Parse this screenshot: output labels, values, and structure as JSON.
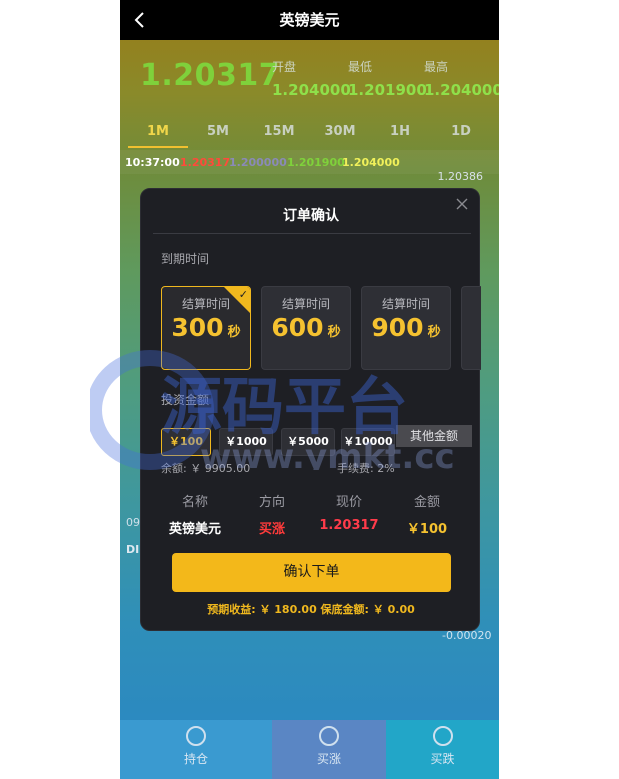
{
  "header": {
    "title": "英镑美元",
    "back_icon": "chevron-left-icon"
  },
  "quote": {
    "price": "1.20317",
    "open_label": "开盘",
    "open_value": "1.204000",
    "low_label": "最低",
    "low_value": "1.201900",
    "high_label": "最高",
    "high_value": "1.204000"
  },
  "tabs": [
    "1M",
    "5M",
    "15M",
    "30M",
    "1H",
    "1D"
  ],
  "active_tab": "1M",
  "chart_bar": {
    "time": "10:37:00",
    "v1": "1.20317",
    "v2": "1.200000",
    "v3": "1.201900",
    "v4": "1.204000"
  },
  "chart_side": {
    "top_label": "1.20386",
    "bottom_label": "-0.00020",
    "time_label": "09",
    "indicator_label": "DI"
  },
  "modal": {
    "title": "订单确认",
    "expiry_label": "到期时间",
    "time_cards": [
      {
        "label": "结算时间",
        "value": "300",
        "unit": "秒",
        "selected": true
      },
      {
        "label": "结算时间",
        "value": "600",
        "unit": "秒",
        "selected": false
      },
      {
        "label": "结算时间",
        "value": "900",
        "unit": "秒",
        "selected": false
      }
    ],
    "invest_label": "投资金额",
    "amounts": [
      "￥100",
      "￥1000",
      "￥5000",
      "￥10000"
    ],
    "selected_amount": "￥100",
    "other_amount": "其他金额",
    "balance": "余额: ￥ 9905.00",
    "fee": "手续费: 2%",
    "table_headers": [
      "名称",
      "方向",
      "现价",
      "金额"
    ],
    "table_values": [
      "英镑美元",
      "买涨",
      "1.20317",
      "￥100"
    ],
    "confirm_label": "确认下单",
    "summary": "预期收益: ￥ 180.00   保底金额: ￥ 0.00"
  },
  "bottom_nav": [
    {
      "label": "持仓",
      "icon": "coins-icon"
    },
    {
      "label": "买涨",
      "icon": "rise-icon"
    },
    {
      "label": "买跌",
      "icon": "fall-icon"
    }
  ],
  "watermark": {
    "text": "源码平台",
    "url": "www.ymkt.cc"
  },
  "colors": {
    "accent": "#f3b81a",
    "up": "#7fd13b",
    "down": "#ff3b3b",
    "modal_bg": "#1e1f24"
  }
}
